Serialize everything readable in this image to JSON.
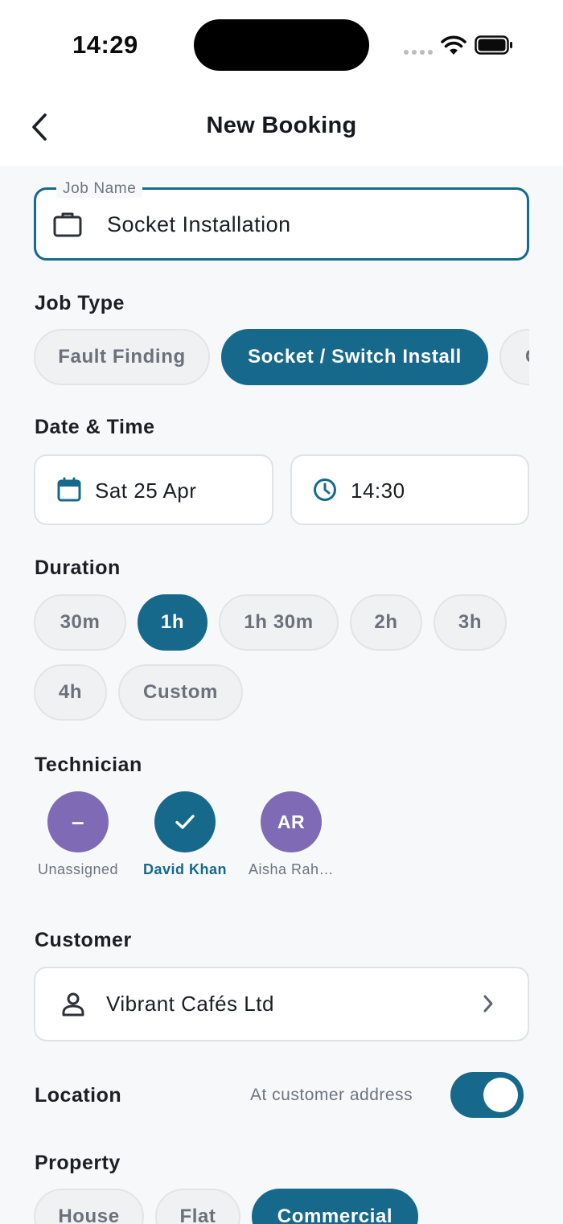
{
  "status_bar": {
    "time": "14:29"
  },
  "header": {
    "title": "New Booking"
  },
  "job_name": {
    "label": "Job Name",
    "value": "Socket Installation"
  },
  "job_type": {
    "label": "Job Type",
    "options": [
      "Fault Finding",
      "Socket / Switch Install",
      "C"
    ],
    "selected": "Socket / Switch Install"
  },
  "date_time": {
    "label": "Date & Time",
    "date": "Sat 25 Apr",
    "time": "14:30"
  },
  "duration": {
    "label": "Duration",
    "options": [
      "30m",
      "1h",
      "1h 30m",
      "2h",
      "3h",
      "4h",
      "Custom"
    ],
    "selected": "1h"
  },
  "technician": {
    "label": "Technician",
    "people": [
      {
        "label": "Unassigned",
        "glyph": "–",
        "selected": false
      },
      {
        "label": "David Khan",
        "glyph": "check-icon",
        "selected": true
      },
      {
        "label": "Aisha Rah…",
        "initials": "AR",
        "selected": false
      }
    ]
  },
  "customer": {
    "label": "Customer",
    "value": "Vibrant Cafés Ltd"
  },
  "location": {
    "label": "Location",
    "note": "At customer address",
    "toggle_on": true
  },
  "property": {
    "label": "Property",
    "options": [
      "House",
      "Flat",
      "Commercial"
    ],
    "selected": "Commercial"
  },
  "colors": {
    "accent": "#17698c",
    "avatar_purple": "#7f6bb5",
    "background": "#f7f8fa"
  }
}
